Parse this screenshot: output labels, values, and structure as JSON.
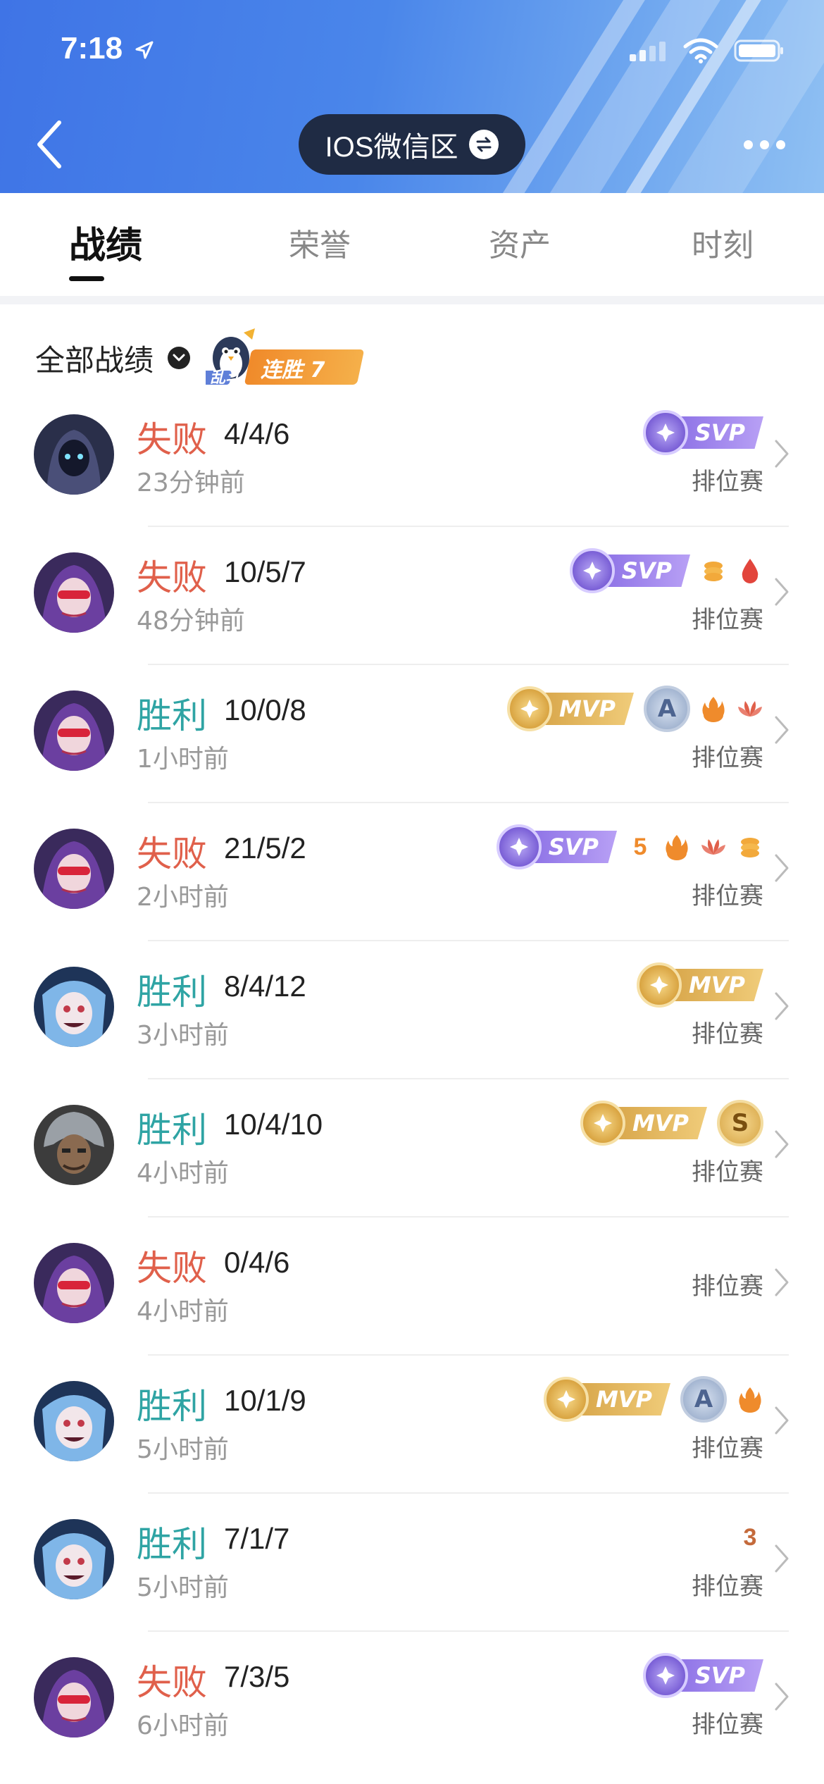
{
  "status_bar": {
    "time": "7:18"
  },
  "header": {
    "server_label": "IOS微信区"
  },
  "tabs": [
    {
      "label": "战绩",
      "active": true
    },
    {
      "label": "荣誉",
      "active": false
    },
    {
      "label": "资产",
      "active": false
    },
    {
      "label": "时刻",
      "active": false
    }
  ],
  "filter": {
    "label": "全部战绩",
    "streak_mode": "乱斗",
    "streak_text": "连胜 7"
  },
  "colors": {
    "loss": "#e0604b",
    "win": "#2fa4a4",
    "header_blue": "#4a86ea"
  },
  "matches": [
    {
      "result": "失败",
      "outcome": "loss",
      "kda": "4/4/6",
      "time": "23分钟前",
      "mode": "排位赛",
      "medal": "SVP",
      "hero_icon": "hooded-assassin-icon"
    },
    {
      "result": "失败",
      "outcome": "loss",
      "kda": "10/5/7",
      "time": "48分钟前",
      "mode": "排位赛",
      "medal": "SVP",
      "hero_icon": "masked-marksman-icon"
    },
    {
      "result": "胜利",
      "outcome": "win",
      "kda": "10/0/8",
      "time": "1小时前",
      "mode": "排位赛",
      "medal": "MVP",
      "hero_icon": "masked-marksman-icon"
    },
    {
      "result": "失败",
      "outcome": "loss",
      "kda": "21/5/2",
      "time": "2小时前",
      "mode": "排位赛",
      "medal": "SVP",
      "hero_icon": "masked-marksman-icon"
    },
    {
      "result": "胜利",
      "outcome": "win",
      "kda": "8/4/12",
      "time": "3小时前",
      "mode": "排位赛",
      "medal": "MVP",
      "hero_icon": "joker-marksman-icon"
    },
    {
      "result": "胜利",
      "outcome": "win",
      "kda": "10/4/10",
      "time": "4小时前",
      "mode": "排位赛",
      "medal": "MVP",
      "hero_icon": "helmet-warrior-icon"
    },
    {
      "result": "失败",
      "outcome": "loss",
      "kda": "0/4/6",
      "time": "4小时前",
      "mode": "排位赛",
      "medal": "",
      "hero_icon": "masked-marksman-icon"
    },
    {
      "result": "胜利",
      "outcome": "win",
      "kda": "10/1/9",
      "time": "5小时前",
      "mode": "排位赛",
      "medal": "MVP",
      "hero_icon": "joker-marksman-icon"
    },
    {
      "result": "胜利",
      "outcome": "win",
      "kda": "7/1/7",
      "time": "5小时前",
      "mode": "排位赛",
      "medal": "",
      "hero_icon": "joker-marksman-icon"
    },
    {
      "result": "失败",
      "outcome": "loss",
      "kda": "7/3/5",
      "time": "6小时前",
      "mode": "排位赛",
      "medal": "SVP",
      "hero_icon": "masked-marksman-icon"
    }
  ]
}
